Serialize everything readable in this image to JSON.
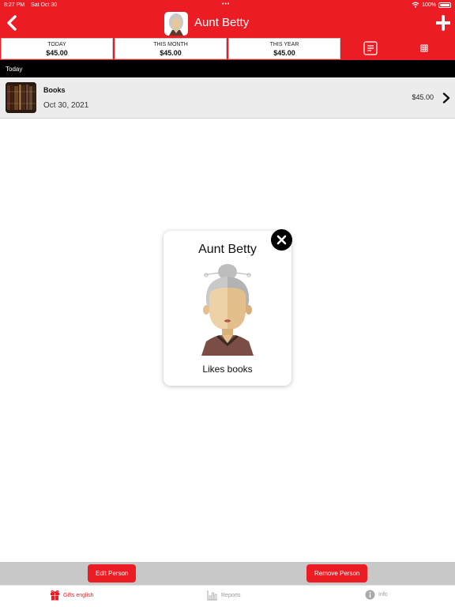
{
  "status_bar": {
    "time": "8:27 PM",
    "date": "Sat Oct 30",
    "battery": "100%"
  },
  "nav": {
    "title": "Aunt Betty",
    "back_icon": "back-chevron-icon",
    "add_icon": "plus-icon"
  },
  "summary": {
    "today_label": "TODAY",
    "today_value": "$45.00",
    "month_label": "THIS MONTH",
    "month_value": "$45.00",
    "year_label": "THIS YEAR",
    "year_value": "$45.00"
  },
  "section": {
    "title": "Today"
  },
  "gift_row": {
    "title": "Books",
    "date": "Oct 30, 2021",
    "amount": "$45.00"
  },
  "popup": {
    "name": "Aunt Betty",
    "note": "Likes books"
  },
  "actions": {
    "edit_label": "Edit Person",
    "remove_label": "Remove Person"
  },
  "tabs": [
    {
      "label": "Gifts english",
      "icon": "gift-icon",
      "active": true
    },
    {
      "label": "Reports",
      "icon": "bar-chart-icon",
      "active": false
    },
    {
      "label": "Info",
      "icon": "info-icon",
      "active": false
    }
  ],
  "colors": {
    "accent": "#ec1c24",
    "header_black": "#000000",
    "row_bg": "#ececec",
    "action_bar": "#c8c8c8"
  }
}
